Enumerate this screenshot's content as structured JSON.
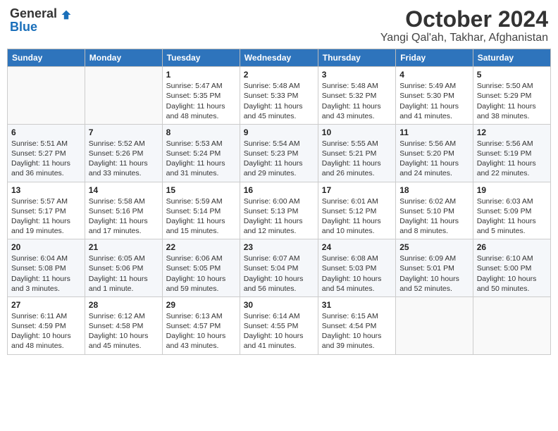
{
  "logo": {
    "general": "General",
    "blue": "Blue"
  },
  "title": "October 2024",
  "location": "Yangi Qal'ah, Takhar, Afghanistan",
  "days_of_week": [
    "Sunday",
    "Monday",
    "Tuesday",
    "Wednesday",
    "Thursday",
    "Friday",
    "Saturday"
  ],
  "weeks": [
    [
      {
        "day": "",
        "info": ""
      },
      {
        "day": "",
        "info": ""
      },
      {
        "day": "1",
        "info": "Sunrise: 5:47 AM\nSunset: 5:35 PM\nDaylight: 11 hours and 48 minutes."
      },
      {
        "day": "2",
        "info": "Sunrise: 5:48 AM\nSunset: 5:33 PM\nDaylight: 11 hours and 45 minutes."
      },
      {
        "day": "3",
        "info": "Sunrise: 5:48 AM\nSunset: 5:32 PM\nDaylight: 11 hours and 43 minutes."
      },
      {
        "day": "4",
        "info": "Sunrise: 5:49 AM\nSunset: 5:30 PM\nDaylight: 11 hours and 41 minutes."
      },
      {
        "day": "5",
        "info": "Sunrise: 5:50 AM\nSunset: 5:29 PM\nDaylight: 11 hours and 38 minutes."
      }
    ],
    [
      {
        "day": "6",
        "info": "Sunrise: 5:51 AM\nSunset: 5:27 PM\nDaylight: 11 hours and 36 minutes."
      },
      {
        "day": "7",
        "info": "Sunrise: 5:52 AM\nSunset: 5:26 PM\nDaylight: 11 hours and 33 minutes."
      },
      {
        "day": "8",
        "info": "Sunrise: 5:53 AM\nSunset: 5:24 PM\nDaylight: 11 hours and 31 minutes."
      },
      {
        "day": "9",
        "info": "Sunrise: 5:54 AM\nSunset: 5:23 PM\nDaylight: 11 hours and 29 minutes."
      },
      {
        "day": "10",
        "info": "Sunrise: 5:55 AM\nSunset: 5:21 PM\nDaylight: 11 hours and 26 minutes."
      },
      {
        "day": "11",
        "info": "Sunrise: 5:56 AM\nSunset: 5:20 PM\nDaylight: 11 hours and 24 minutes."
      },
      {
        "day": "12",
        "info": "Sunrise: 5:56 AM\nSunset: 5:19 PM\nDaylight: 11 hours and 22 minutes."
      }
    ],
    [
      {
        "day": "13",
        "info": "Sunrise: 5:57 AM\nSunset: 5:17 PM\nDaylight: 11 hours and 19 minutes."
      },
      {
        "day": "14",
        "info": "Sunrise: 5:58 AM\nSunset: 5:16 PM\nDaylight: 11 hours and 17 minutes."
      },
      {
        "day": "15",
        "info": "Sunrise: 5:59 AM\nSunset: 5:14 PM\nDaylight: 11 hours and 15 minutes."
      },
      {
        "day": "16",
        "info": "Sunrise: 6:00 AM\nSunset: 5:13 PM\nDaylight: 11 hours and 12 minutes."
      },
      {
        "day": "17",
        "info": "Sunrise: 6:01 AM\nSunset: 5:12 PM\nDaylight: 11 hours and 10 minutes."
      },
      {
        "day": "18",
        "info": "Sunrise: 6:02 AM\nSunset: 5:10 PM\nDaylight: 11 hours and 8 minutes."
      },
      {
        "day": "19",
        "info": "Sunrise: 6:03 AM\nSunset: 5:09 PM\nDaylight: 11 hours and 5 minutes."
      }
    ],
    [
      {
        "day": "20",
        "info": "Sunrise: 6:04 AM\nSunset: 5:08 PM\nDaylight: 11 hours and 3 minutes."
      },
      {
        "day": "21",
        "info": "Sunrise: 6:05 AM\nSunset: 5:06 PM\nDaylight: 11 hours and 1 minute."
      },
      {
        "day": "22",
        "info": "Sunrise: 6:06 AM\nSunset: 5:05 PM\nDaylight: 10 hours and 59 minutes."
      },
      {
        "day": "23",
        "info": "Sunrise: 6:07 AM\nSunset: 5:04 PM\nDaylight: 10 hours and 56 minutes."
      },
      {
        "day": "24",
        "info": "Sunrise: 6:08 AM\nSunset: 5:03 PM\nDaylight: 10 hours and 54 minutes."
      },
      {
        "day": "25",
        "info": "Sunrise: 6:09 AM\nSunset: 5:01 PM\nDaylight: 10 hours and 52 minutes."
      },
      {
        "day": "26",
        "info": "Sunrise: 6:10 AM\nSunset: 5:00 PM\nDaylight: 10 hours and 50 minutes."
      }
    ],
    [
      {
        "day": "27",
        "info": "Sunrise: 6:11 AM\nSunset: 4:59 PM\nDaylight: 10 hours and 48 minutes."
      },
      {
        "day": "28",
        "info": "Sunrise: 6:12 AM\nSunset: 4:58 PM\nDaylight: 10 hours and 45 minutes."
      },
      {
        "day": "29",
        "info": "Sunrise: 6:13 AM\nSunset: 4:57 PM\nDaylight: 10 hours and 43 minutes."
      },
      {
        "day": "30",
        "info": "Sunrise: 6:14 AM\nSunset: 4:55 PM\nDaylight: 10 hours and 41 minutes."
      },
      {
        "day": "31",
        "info": "Sunrise: 6:15 AM\nSunset: 4:54 PM\nDaylight: 10 hours and 39 minutes."
      },
      {
        "day": "",
        "info": ""
      },
      {
        "day": "",
        "info": ""
      }
    ]
  ]
}
